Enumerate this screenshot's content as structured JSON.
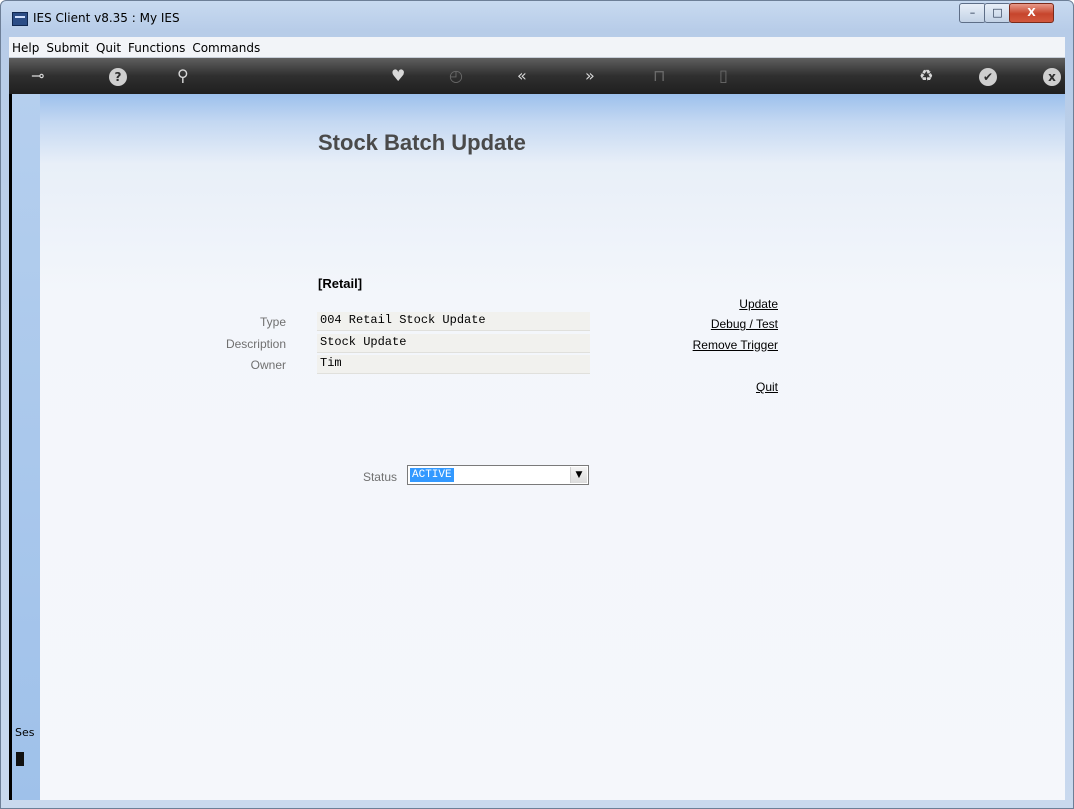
{
  "window": {
    "title": "IES Client v8.35 : My IES",
    "min_symbol": "–",
    "max_symbol": "□",
    "close_symbol": "X"
  },
  "menu": {
    "items": [
      "Help",
      "Submit",
      "Quit",
      "Functions",
      "Commands"
    ]
  },
  "toolbar": {
    "icons": [
      "key-icon",
      "help-icon",
      "search-icon",
      "heart-icon",
      "clock-icon",
      "back-icon",
      "forward-icon",
      "trash-icon",
      "page-icon",
      "recycle-icon",
      "check-icon",
      "close-icon"
    ],
    "help_glyph": "?",
    "search_glyph": "⚲",
    "heart_glyph": "♥",
    "clock_glyph": "◴",
    "back_glyph": "«",
    "forward_glyph": "»",
    "trash_glyph": "⊓",
    "page_glyph": "▯",
    "recycle_glyph": "♻",
    "check_glyph": "✔",
    "close_glyph": "x",
    "key_glyph": "⊸"
  },
  "page": {
    "title": "Stock Batch Update",
    "section_label": "[Retail]"
  },
  "form": {
    "type_label": "Type",
    "type_value": "004 Retail Stock Update",
    "description_label": "Description",
    "description_value": "Stock Update",
    "owner_label": "Owner",
    "owner_value": "Tim"
  },
  "actions": {
    "update": "Update",
    "debug": "Debug / Test",
    "remove_trigger": "Remove Trigger",
    "quit": "Quit"
  },
  "status": {
    "label": "Status",
    "value": "ACTIVE"
  },
  "sidebar": {
    "session_text": "Ses"
  }
}
